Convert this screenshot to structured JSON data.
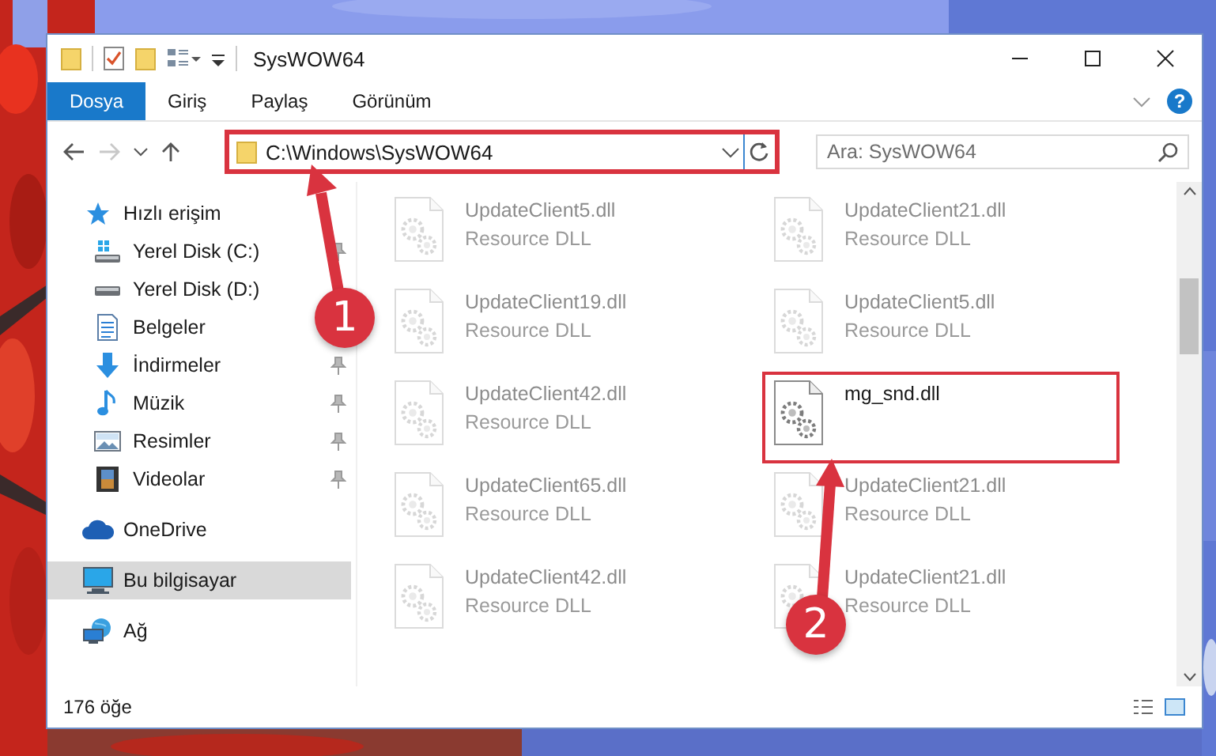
{
  "window": {
    "title": "SysWOW64"
  },
  "ribbon": {
    "tabs": [
      {
        "label": "Dosya",
        "selected": true
      },
      {
        "label": "Giriş",
        "selected": false
      },
      {
        "label": "Paylaş",
        "selected": false
      },
      {
        "label": "Görünüm",
        "selected": false
      }
    ],
    "help": "?"
  },
  "address": {
    "path": "C:\\Windows\\SysWOW64",
    "highlighted": true
  },
  "search": {
    "placeholder": "Ara: SysWOW64"
  },
  "sidebar": {
    "items": [
      {
        "label": "Hızlı erişim",
        "kind": "star",
        "selected": false,
        "children": [
          {
            "label": "Yerel Disk (C:)",
            "kind": "windrive",
            "pinned": true,
            "selected": false
          },
          {
            "label": "Yerel Disk (D:)",
            "kind": "drive",
            "pinned": false,
            "selected": false
          },
          {
            "label": "Belgeler",
            "kind": "documents",
            "pinned": false,
            "selected": false
          },
          {
            "label": "İndirmeler",
            "kind": "download",
            "pinned": true,
            "selected": false
          },
          {
            "label": "Müzik",
            "kind": "music",
            "pinned": true,
            "selected": false
          },
          {
            "label": "Resimler",
            "kind": "pictures",
            "pinned": true,
            "selected": false
          },
          {
            "label": "Videolar",
            "kind": "video",
            "pinned": true,
            "selected": false
          }
        ]
      },
      {
        "label": "OneDrive",
        "kind": "cloud",
        "selected": false
      },
      {
        "label": "Bu bilgisayar",
        "kind": "computer",
        "selected": true
      },
      {
        "label": "Ağ",
        "kind": "network",
        "selected": false
      }
    ]
  },
  "files": [
    {
      "name": "UpdateClient5.dll",
      "type": "Resource DLL",
      "blurred": true,
      "highlighted": false
    },
    {
      "name": "UpdateClient21.dll",
      "type": "Resource DLL",
      "blurred": true,
      "highlighted": false
    },
    {
      "name": "UpdateClient19.dll",
      "type": "Resource DLL",
      "blurred": true,
      "highlighted": false
    },
    {
      "name": "UpdateClient5.dll",
      "type": "Resource DLL",
      "blurred": true,
      "highlighted": false
    },
    {
      "name": "UpdateClient42.dll",
      "type": "Resource DLL",
      "blurred": true,
      "highlighted": false
    },
    {
      "name": "mg_snd.dll",
      "blurred": false,
      "highlighted": true
    },
    {
      "name": "UpdateClient65.dll",
      "type": "Resource DLL",
      "blurred": true,
      "highlighted": false
    },
    {
      "name": "UpdateClient21.dll",
      "type": "Resource DLL",
      "blurred": true,
      "highlighted": false
    },
    {
      "name": "UpdateClient42.dll",
      "type": "Resource DLL",
      "blurred": true,
      "highlighted": false
    },
    {
      "name": "UpdateClient21.dll",
      "type": "Resource DLL",
      "blurred": true,
      "highlighted": false
    }
  ],
  "status_bar": {
    "count": "176 öğe"
  },
  "annotations": [
    {
      "label": "1"
    },
    {
      "label": "2"
    }
  ]
}
